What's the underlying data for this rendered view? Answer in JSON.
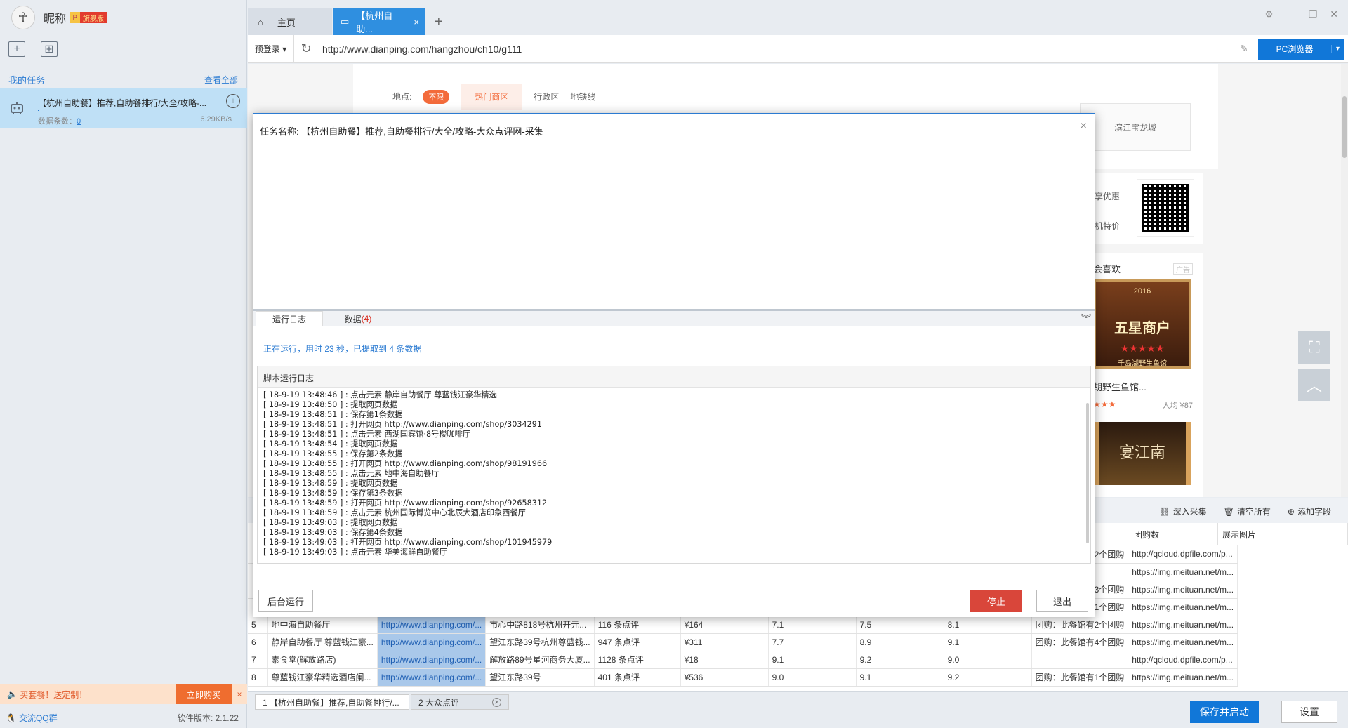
{
  "sidebar": {
    "nickname": "昵称",
    "vip_p": "P",
    "vip_label": "旗舰版",
    "my_tasks": "我的任务",
    "view_all": "查看全部",
    "task": {
      "title": "【杭州自助餐】推荐,自助餐排行/大全/攻略-...",
      "count_label": "数据条数：",
      "count_value": "0",
      "speed": "6.29KB/s"
    },
    "promo_text": "买套餐！送定制！",
    "promo_buy": "立即购买",
    "promo_close": "×",
    "qq_group": "交流QQ群",
    "version": "软件版本: 2.1.22"
  },
  "tabs": {
    "home": "主页",
    "active": "【杭州自助...",
    "active_close": "×",
    "add": "+"
  },
  "address": {
    "prelogin": "预登录",
    "url": "http://www.dianping.com/hangzhou/ch10/g111",
    "browser_button": "PC浏览器"
  },
  "page": {
    "filter_label": "地点:",
    "filter_all": "不限",
    "filter_hot": "热门商区",
    "filter_district": "行政区",
    "filter_metro": "地铁线",
    "mall": "滨江宝龙城",
    "promo_line1": "享优惠",
    "promo_line2": "机特价",
    "like_title": "会喜欢",
    "ad_tag": "广告",
    "shop1_year": "2016",
    "shop1_banner": "五星商户",
    "shop1_stars": "★★★★★",
    "shop1_name": "千岛湖野生鱼馆",
    "shop1_caption": "胡野生鱼馆...",
    "shop1_rating": "★★★",
    "shop1_avg": "人均 ¥87",
    "shop2_name": "宴江南"
  },
  "data_panel": {
    "deep_collect": "深入采集",
    "clear_all": "清空所有",
    "add_field": "添加字段",
    "col_group": "团购数",
    "col_image": "展示图片",
    "rows": [
      {
        "idx": "",
        "name": "",
        "link": "",
        "addr": "",
        "reviews": "",
        "price": "",
        "s1": "",
        "s2": "",
        "s3": "",
        "group": "团购：此餐馆有2个团购",
        "image": "http://qcloud.dpfile.com/p..."
      },
      {
        "idx": "",
        "name": "",
        "link": "",
        "addr": "",
        "reviews": "",
        "price": "",
        "s1": "",
        "s2": "",
        "s3": "",
        "group": "",
        "image": "https://img.meituan.net/m..."
      },
      {
        "idx": "",
        "name": "",
        "link": "",
        "addr": "",
        "reviews": "",
        "price": "",
        "s1": "",
        "s2": "",
        "s3": "",
        "group": "团购：此餐馆有3个团购",
        "image": "https://img.meituan.net/m..."
      },
      {
        "idx": "",
        "name": "",
        "link": "",
        "addr": "",
        "reviews": "",
        "price": "",
        "s1": "",
        "s2": "",
        "s3": "",
        "group": "团购：此餐馆有1个团购",
        "image": "https://img.meituan.net/m..."
      },
      {
        "idx": "5",
        "name": "地中海自助餐厅",
        "link": "http://www.dianping.com/...",
        "addr": "市心中路818号杭州开元...",
        "reviews": "116 条点评",
        "price": "¥164",
        "s1": "7.1",
        "s2": "7.5",
        "s3": "8.1",
        "group": "团购：此餐馆有2个团购",
        "image": "https://img.meituan.net/m..."
      },
      {
        "idx": "6",
        "name": "静岸自助餐厅 尊蓝钱江豪...",
        "link": "http://www.dianping.com/...",
        "addr": "望江东路39号杭州尊蓝钱...",
        "reviews": "947 条点评",
        "price": "¥311",
        "s1": "7.7",
        "s2": "8.9",
        "s3": "9.1",
        "group": "团购：此餐馆有4个团购",
        "image": "https://img.meituan.net/m..."
      },
      {
        "idx": "7",
        "name": "素食堂(解放路店)",
        "link": "http://www.dianping.com/...",
        "addr": "解放路89号星河商务大厦...",
        "reviews": "1128 条点评",
        "price": "¥18",
        "s1": "9.1",
        "s2": "9.2",
        "s3": "9.0",
        "group": "",
        "image": "http://qcloud.dpfile.com/p..."
      },
      {
        "idx": "8",
        "name": "尊蓝钱江豪华精选酒店阑...",
        "link": "http://www.dianping.com/...",
        "addr": "望江东路39号",
        "reviews": "401 条点评",
        "price": "¥536",
        "s1": "9.0",
        "s2": "9.1",
        "s3": "9.2",
        "group": "团购：此餐馆有1个团购",
        "image": "https://img.meituan.net/m..."
      }
    ]
  },
  "bottom": {
    "tab1": "1 【杭州自助餐】推荐,自助餐排行/...",
    "tab2": "2 大众点评",
    "save_start": "保存并启动",
    "settings": "设置"
  },
  "modal": {
    "task_name": "任务名称: 【杭州自助餐】推荐,自助餐排行/大全/攻略-大众点评网-采集",
    "close": "×",
    "tab_log": "运行日志",
    "tab_data": "数据",
    "tab_data_count": "(4)",
    "status": "正在运行，用时 23 秒，已提取到 4 条数据",
    "log_header": "脚本运行日志",
    "log_lines": [
      "[ 18-9-19 13:48:46 ] : 点击元素 静岸自助餐厅 尊蓝钱江豪华精选",
      "[ 18-9-19 13:48:50 ] : 提取网页数据",
      "[ 18-9-19 13:48:51 ] : 保存第1条数据",
      "[ 18-9-19 13:48:51 ] : 打开网页 http://www.dianping.com/shop/3034291",
      "[ 18-9-19 13:48:51 ] : 点击元素 西湖国宾馆·8号楼咖啡厅",
      "[ 18-9-19 13:48:54 ] : 提取网页数据",
      "[ 18-9-19 13:48:55 ] : 保存第2条数据",
      "[ 18-9-19 13:48:55 ] : 打开网页 http://www.dianping.com/shop/98191966",
      "[ 18-9-19 13:48:55 ] : 点击元素 地中海自助餐厅",
      "[ 18-9-19 13:48:59 ] : 提取网页数据",
      "[ 18-9-19 13:48:59 ] : 保存第3条数据",
      "[ 18-9-19 13:48:59 ] : 打开网页 http://www.dianping.com/shop/92658312",
      "[ 18-9-19 13:48:59 ] : 点击元素 杭州国际博览中心北辰大酒店印象西餐厅",
      "[ 18-9-19 13:49:03 ] : 提取网页数据",
      "[ 18-9-19 13:49:03 ] : 保存第4条数据",
      "[ 18-9-19 13:49:03 ] : 打开网页 http://www.dianping.com/shop/101945979",
      "[ 18-9-19 13:49:03 ] : 点击元素 华美海鲜自助餐厅"
    ],
    "bg_run": "后台运行",
    "stop": "停止",
    "exit": "退出"
  }
}
